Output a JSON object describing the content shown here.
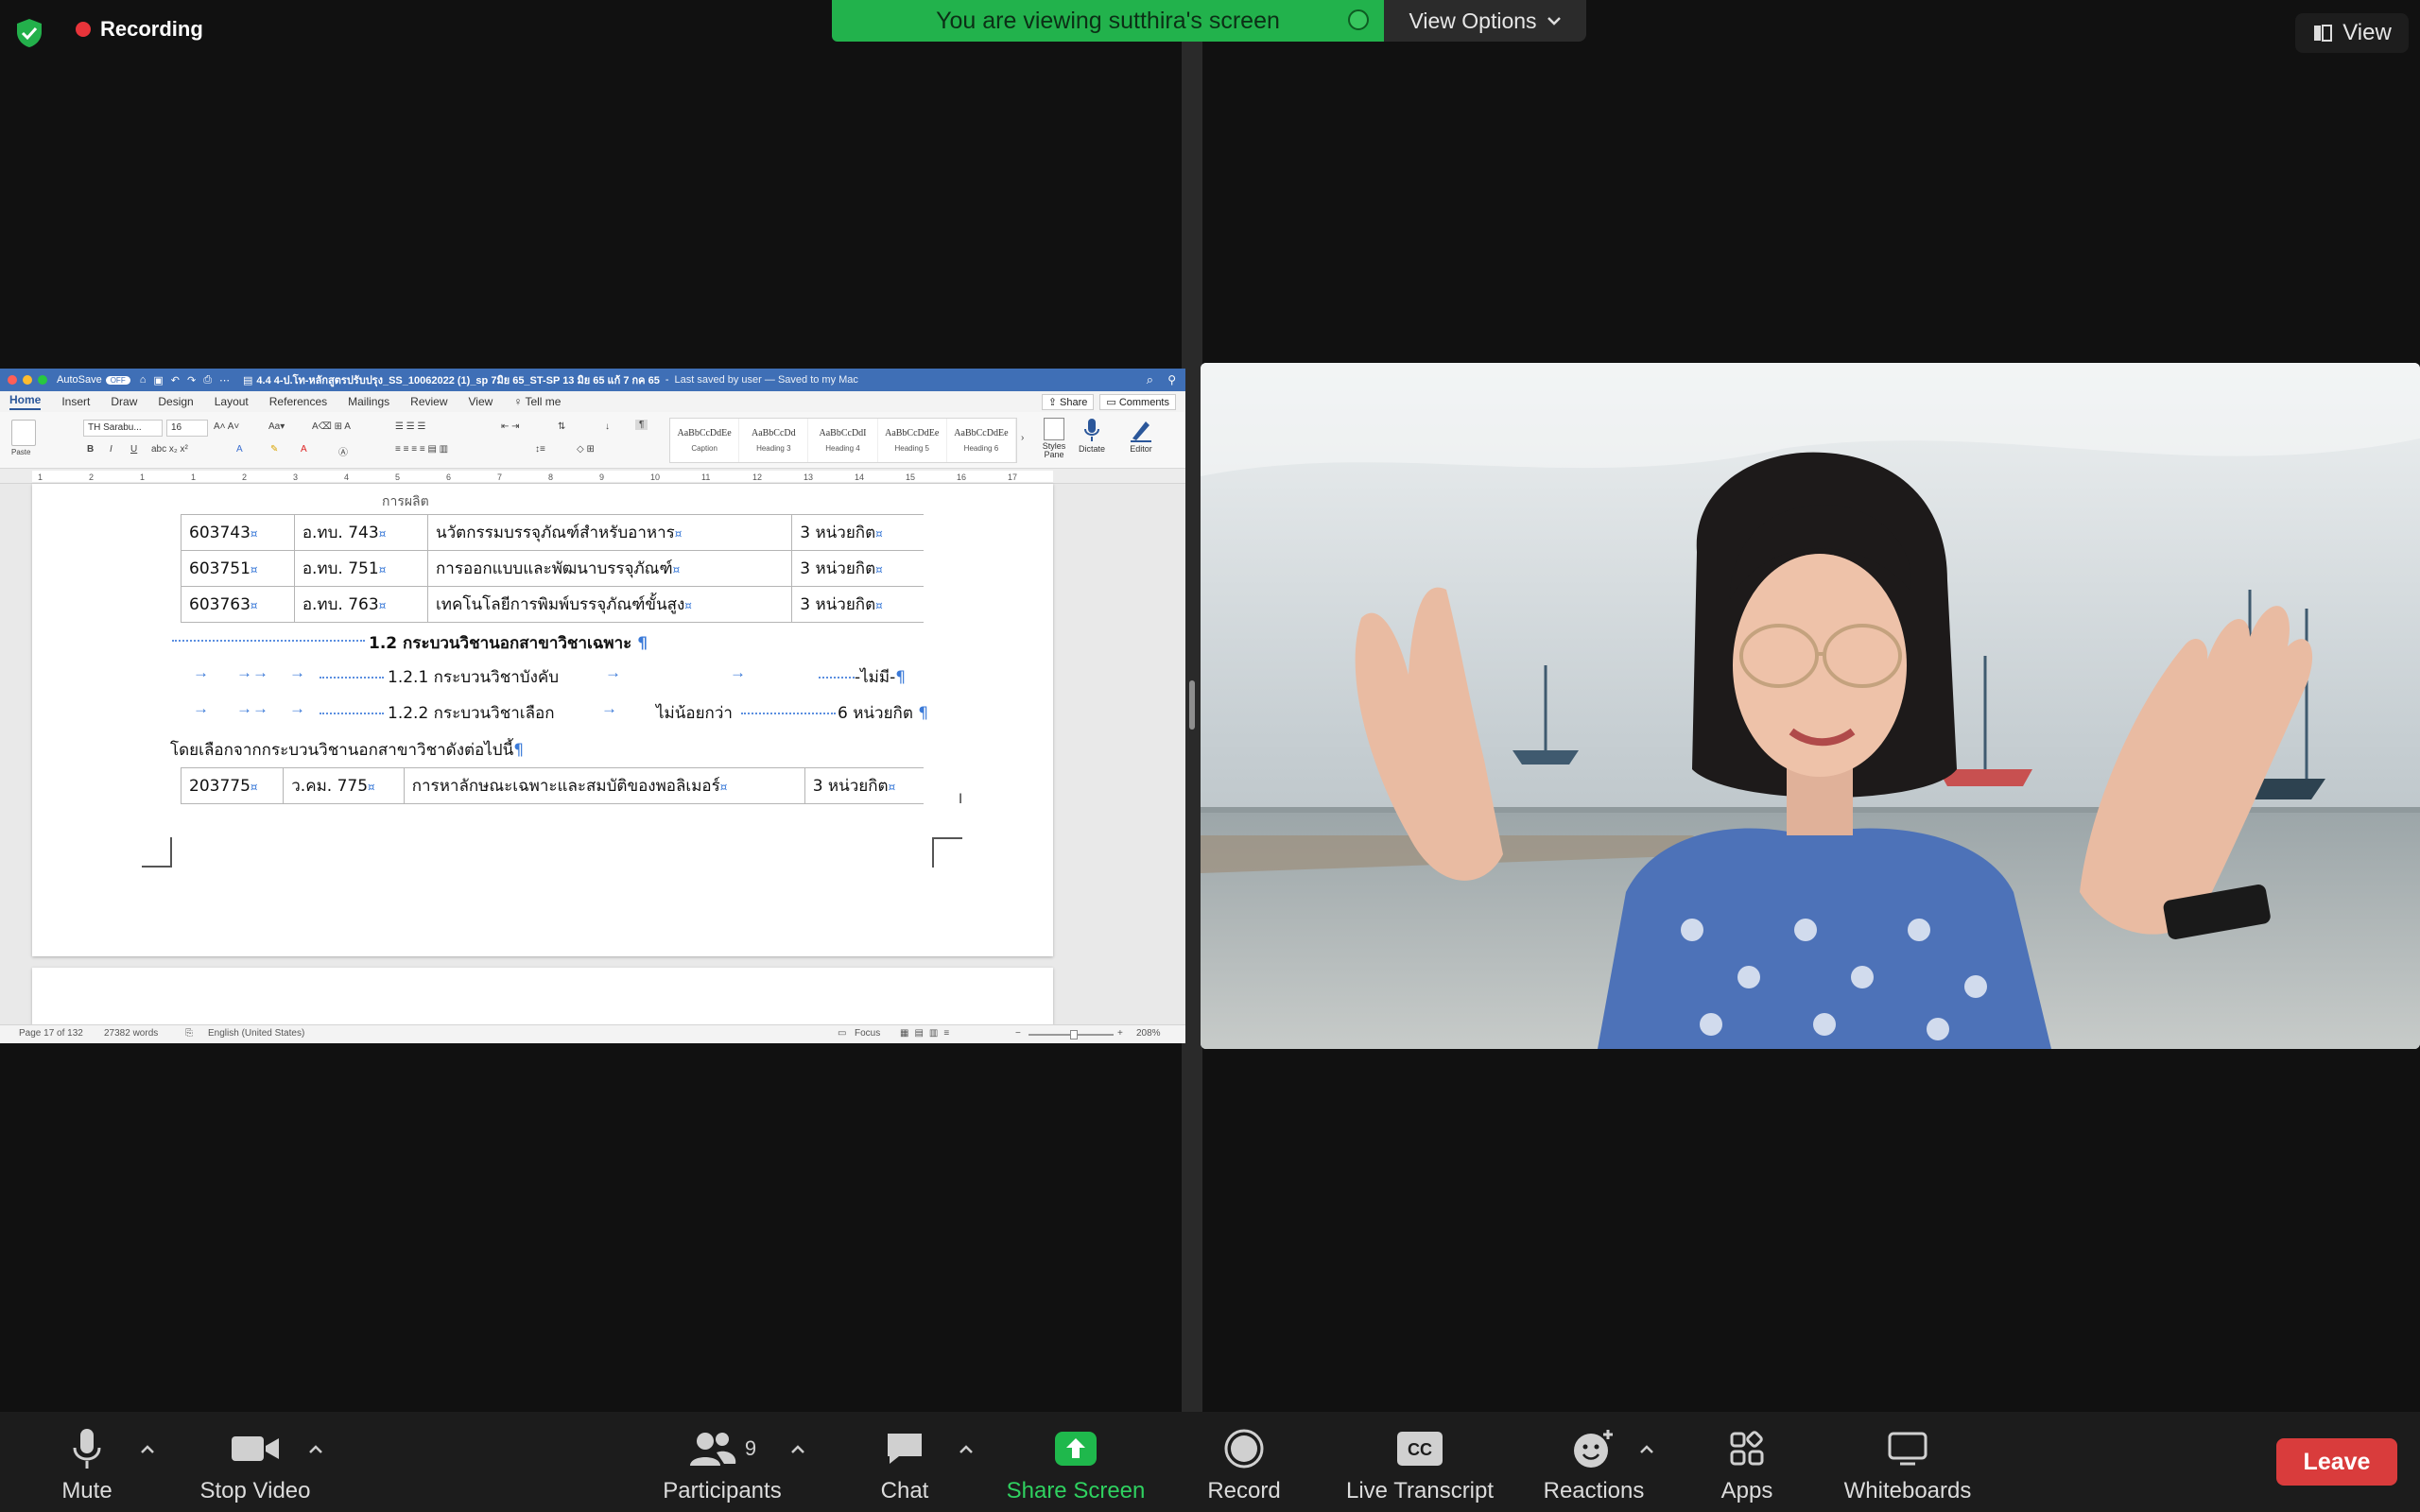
{
  "meeting": {
    "recording_label": "Recording",
    "banner_text": "You are viewing sutthira's screen",
    "view_options_label": "View Options",
    "view_label": "View"
  },
  "word": {
    "autosave_label": "AutoSave",
    "autosave_state": "OFF",
    "doc_title": "4.4 4-ป.โท-หลักสูตรปรับปรุง_SS_10062022 (1)_sp 7มิย 65_ST-SP 13 มิย 65 แก้ 7 กค 65",
    "save_status": "Last saved by user — Saved to my Mac",
    "tabs": [
      "Home",
      "Insert",
      "Draw",
      "Design",
      "Layout",
      "References",
      "Mailings",
      "Review",
      "View"
    ],
    "tell_me": "Tell me",
    "share_label": "Share",
    "comments_label": "Comments",
    "paste_label": "Paste",
    "font_name": "TH Sarabu...",
    "font_size": "16",
    "styles": [
      {
        "preview": "AaBbCcDdEe",
        "name": "Caption"
      },
      {
        "preview": "AaBbCcDd",
        "name": "Heading 3"
      },
      {
        "preview": "AaBbCcDdI",
        "name": "Heading 4"
      },
      {
        "preview": "AaBbCcDdEe",
        "name": "Heading 5"
      },
      {
        "preview": "AaBbCcDdEe",
        "name": "Heading 6"
      }
    ],
    "styles_pane_label": "Styles Pane",
    "dictate_label": "Dictate",
    "editor_label": "Editor",
    "ruler_numbers": [
      "1",
      "2",
      "1",
      "1",
      "2",
      "3",
      "4",
      "5",
      "6",
      "7",
      "8",
      "9",
      "10",
      "11",
      "12",
      "13",
      "14",
      "15",
      "16",
      "17"
    ],
    "table_top_partial": "การผลิต",
    "table1": [
      {
        "code": "603743",
        "abbr": "อ.ทบ. 743",
        "name": "นวัตกรรมบรรจุภัณฑ์สำหรับอาหาร",
        "credit": "3 หน่วยกิต"
      },
      {
        "code": "603751",
        "abbr": "อ.ทบ. 751",
        "name": "การออกแบบและพัฒนาบรรจุภัณฑ์",
        "credit": "3 หน่วยกิต"
      },
      {
        "code": "603763",
        "abbr": "อ.ทบ. 763",
        "name": "เทคโนโลยีการพิมพ์บรรจุภัณฑ์ขั้นสูง",
        "credit": "3 หน่วยกิต"
      }
    ],
    "section_heading": "1.2 กระบวนวิชานอกสาขาวิชาเฉพาะ",
    "line1_label": "1.2.1 กระบวนวิชาบังคับ",
    "line1_value": "-ไม่มี-",
    "line2_label": "1.2.2 กระบวนวิชาเลือก",
    "line2_mid": "ไม่น้อยกว่า",
    "line2_value": "6 หน่วยกิต",
    "paragraph": "โดยเลือกจากกระบวนวิชานอกสาขาวิชาดังต่อไปนี้",
    "table2": [
      {
        "code": "203775",
        "abbr": "ว.คม. 775",
        "name": "การหาลักษณะเฉพาะและสมบัติของพอลิเมอร์",
        "credit": "3 หน่วยกิต"
      }
    ],
    "status_page": "Page 17 of 132",
    "status_words": "27382 words",
    "status_language": "English (United States)",
    "status_focus": "Focus",
    "zoom": "208%"
  },
  "controls": {
    "mute": "Mute",
    "stop_video": "Stop Video",
    "participants": "Participants",
    "participants_count": "9",
    "chat": "Chat",
    "share_screen": "Share Screen",
    "record": "Record",
    "live_transcript": "Live Transcript",
    "reactions": "Reactions",
    "apps": "Apps",
    "whiteboards": "Whiteboards",
    "leave": "Leave"
  },
  "colors": {
    "banner_green": "#22b24c",
    "share_green": "#1fb84c",
    "leave_red": "#d93c3c",
    "recording_red": "#e8343a",
    "word_blue": "#3f6fb6"
  }
}
